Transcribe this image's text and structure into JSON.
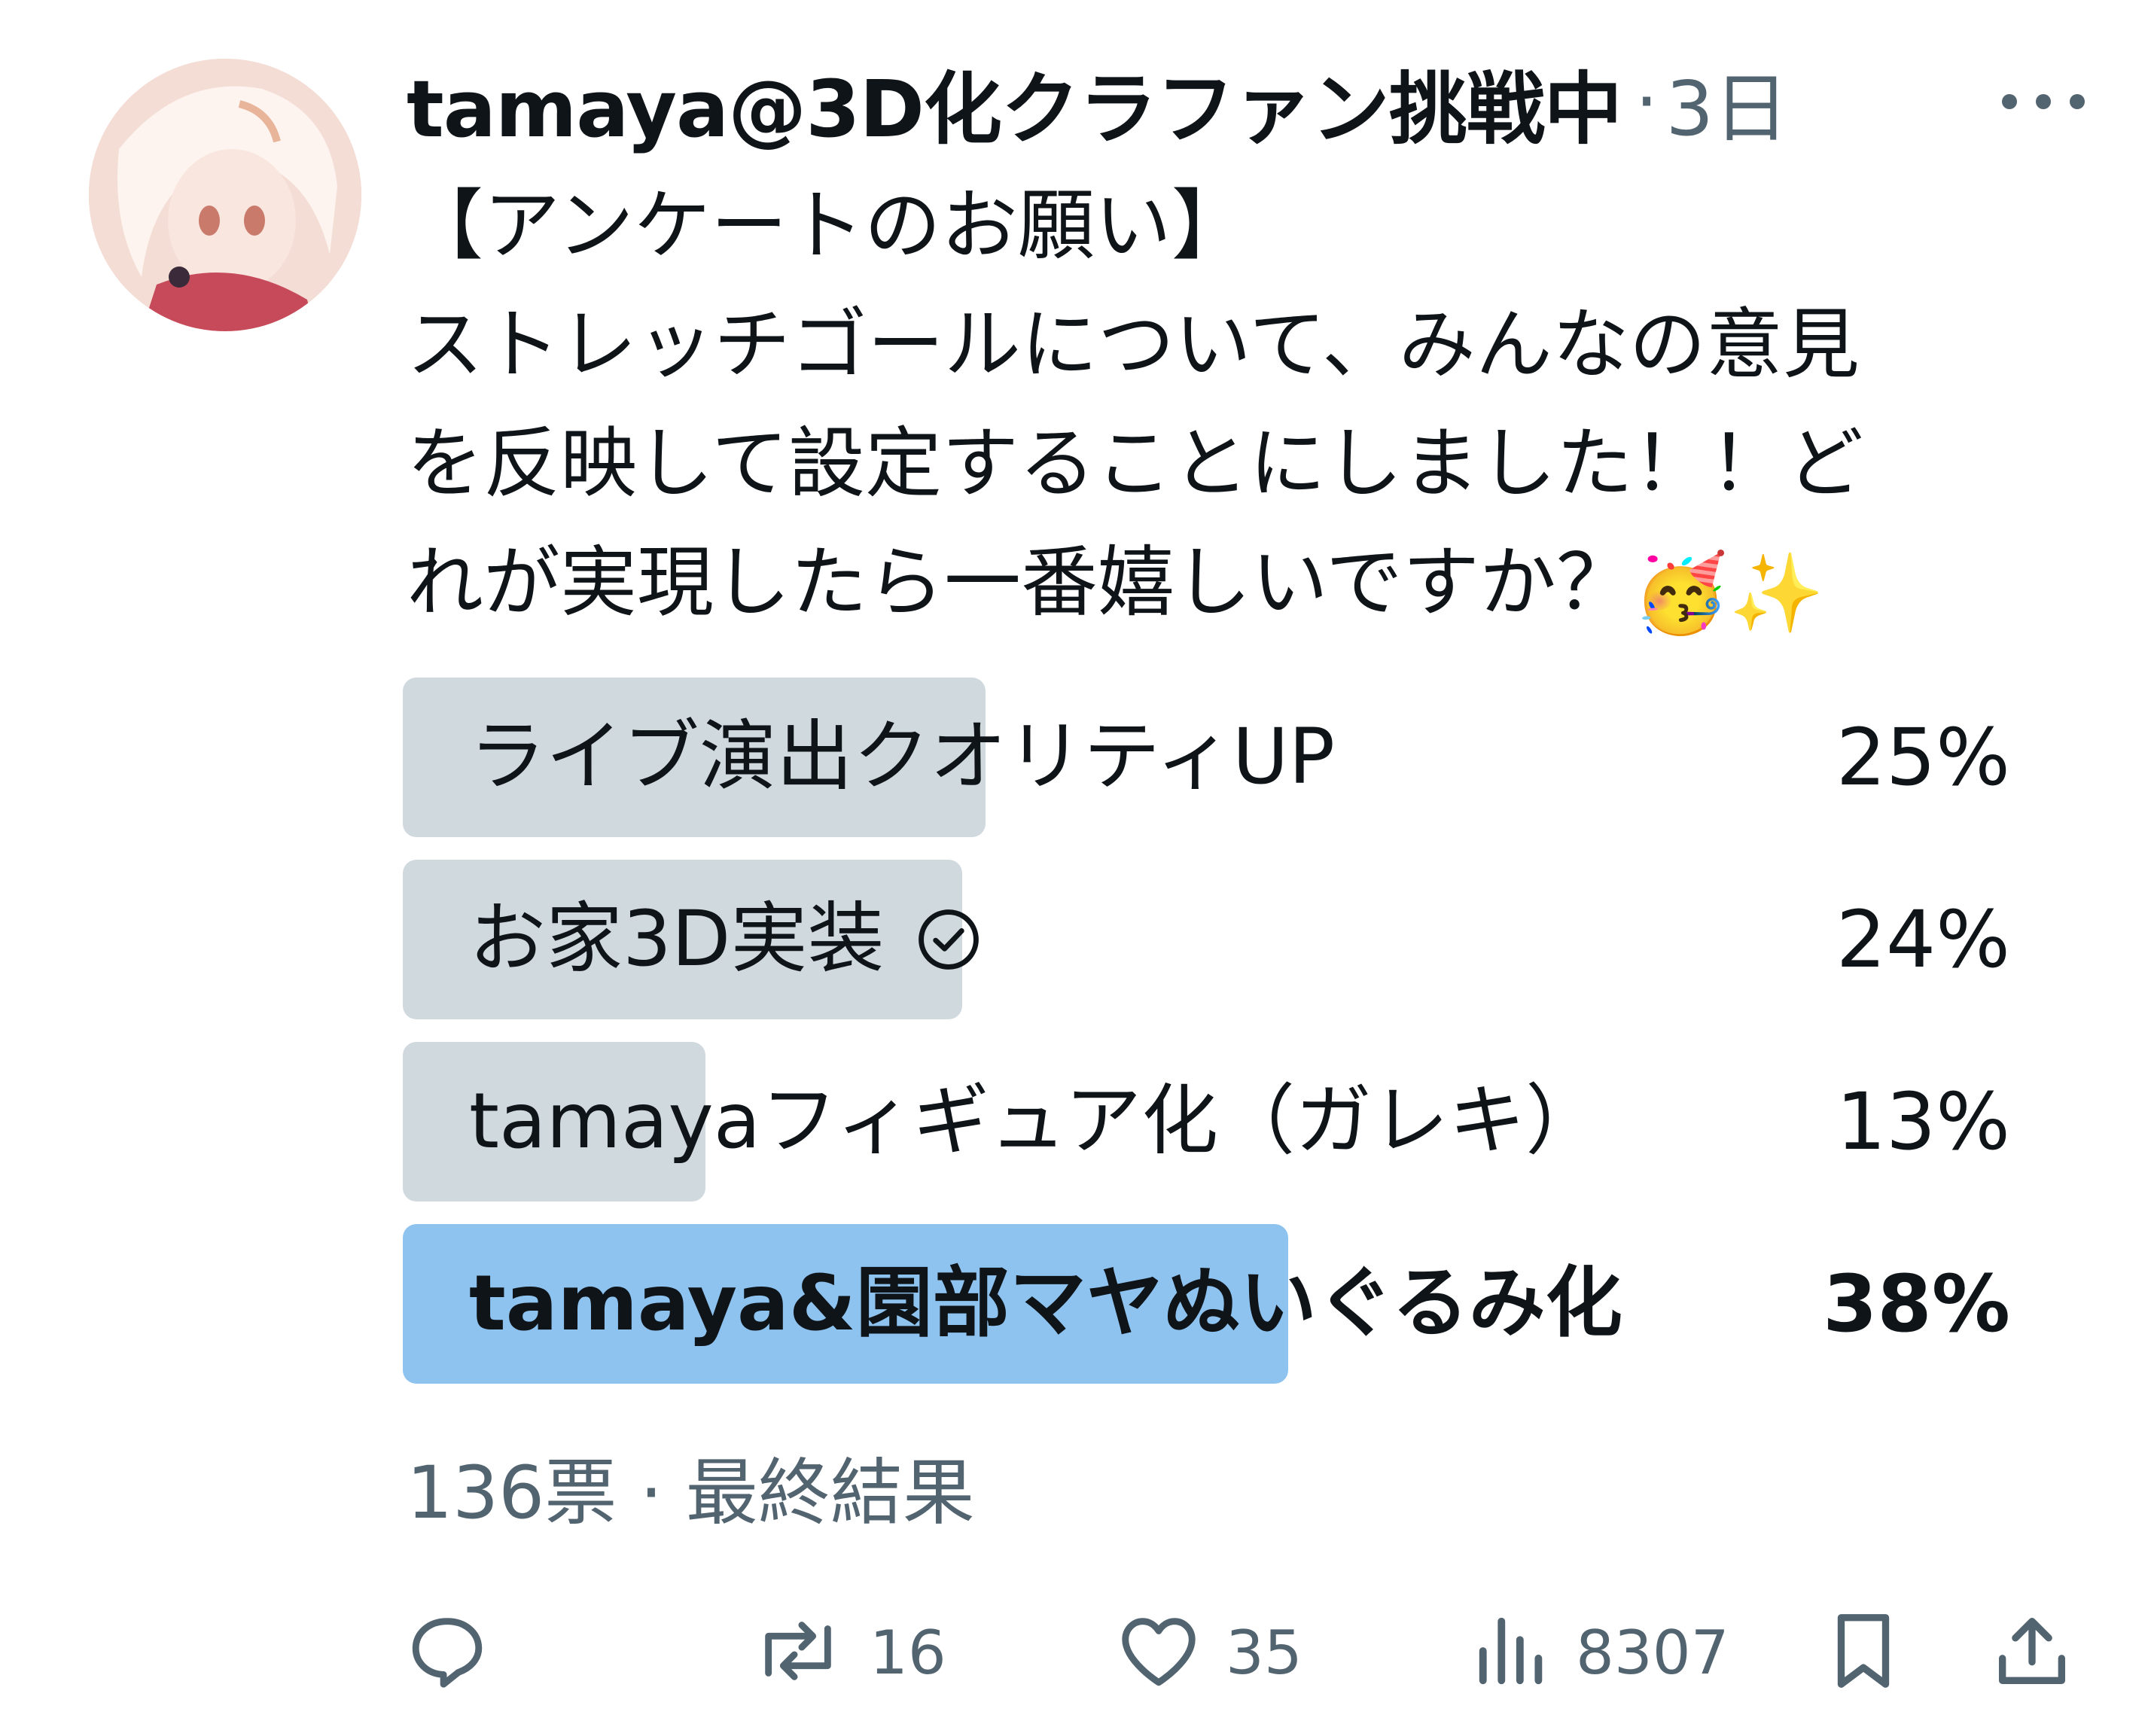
{
  "tweet": {
    "author": "tamaya@3D化クラファン挑戦中",
    "separator": "·",
    "time": "3日",
    "text_line1": "【アンケートのお願い】",
    "text_line2": "ストレッチゴールについて、みんなの意見",
    "text_line3": "を反映して設定することにしました！！ど",
    "text_line4": "れが実現したら一番嬉しいですか？",
    "emoji_1": "🥳",
    "emoji_2": "✨"
  },
  "poll": {
    "options": [
      {
        "label": "ライブ演出クオリティUP",
        "percent_label": "25%",
        "percent": 25,
        "selected": false
      },
      {
        "label": "お家3D実装",
        "percent_label": "24%",
        "percent": 24,
        "selected": true
      },
      {
        "label": "tamayaフィギュア化（ガレキ）",
        "percent_label": "13%",
        "percent": 13,
        "selected": false
      },
      {
        "label": "tamaya&園部マヤぬいぐるみ化",
        "percent_label": "38%",
        "percent": 38,
        "selected": false,
        "winner": true
      }
    ],
    "votes": "136票",
    "separator": "·",
    "status": "最終結果"
  },
  "actions": {
    "reply_icon": "reply-icon",
    "retweet_icon": "retweet-icon",
    "retweet_count": "16",
    "like_icon": "heart-icon",
    "like_count": "35",
    "views_icon": "views-icon",
    "views_count": "8307",
    "bookmark_icon": "bookmark-icon",
    "share_icon": "share-icon"
  },
  "colors": {
    "text": "#0f1419",
    "secondary": "#536471",
    "bar_default": "#cfd9de",
    "bar_winner": "#8ec3f0"
  }
}
